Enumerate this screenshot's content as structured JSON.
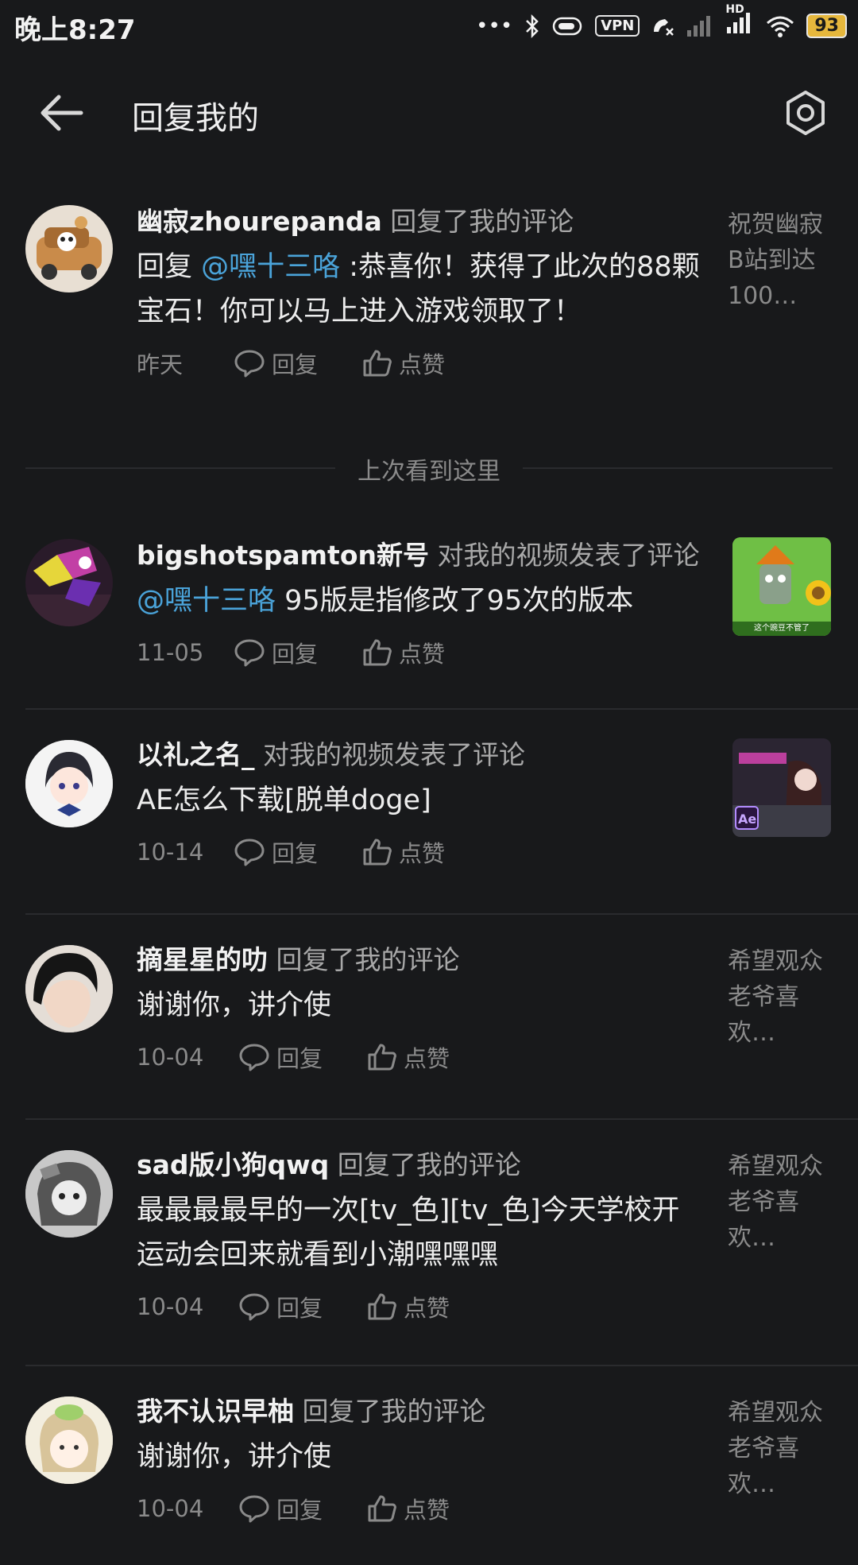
{
  "status": {
    "time": "晚上8:27",
    "vpn": "VPN",
    "signal_hd": "HD",
    "battery": "93"
  },
  "header": {
    "title": "回复我的"
  },
  "last_seen_label": "上次看到这里",
  "actions": {
    "reply": "回复",
    "like": "点赞"
  },
  "items": [
    {
      "user": "幽寂zhourepanda",
      "action": "回复了我的评论",
      "content_prefix": "回复 ",
      "mention": "@嘿十三咯",
      "content_suffix": " :恭喜你！获得了此次的88颗宝石！你可以马上进入游戏领取了！",
      "date": "昨天",
      "side_text": "祝贺幽寂B站到达100…"
    },
    {
      "user": "bigshotspamton新号",
      "action": "对我的视频发表了评论",
      "content_prefix": "",
      "mention": "@嘿十三咯",
      "content_suffix": " 95版是指修改了95次的版本",
      "date": "11-05",
      "thumb_caption": "这个豌豆不管了"
    },
    {
      "user": "以礼之名_",
      "action": "对我的视频发表了评论",
      "content_prefix": "AE怎么下载[脱单doge]",
      "mention": "",
      "content_suffix": "",
      "date": "10-14",
      "thumb_caption": "Ae"
    },
    {
      "user": "摘星星的叻",
      "action": "回复了我的评论",
      "content_prefix": "谢谢你，讲介使",
      "mention": "",
      "content_suffix": "",
      "date": "10-04",
      "side_text": "希望观众老爷喜欢…"
    },
    {
      "user": "sad版小狗qwq",
      "action": "回复了我的评论",
      "content_prefix": "最最最最早的一次[tv_色][tv_色]今天学校开运动会回来就看到小潮嘿嘿嘿",
      "mention": "",
      "content_suffix": "",
      "date": "10-04",
      "side_text": "希望观众老爷喜欢…"
    },
    {
      "user": "我不认识早柚",
      "action": "回复了我的评论",
      "content_prefix": "谢谢你，讲介使",
      "mention": "",
      "content_suffix": "",
      "date": "10-04",
      "side_text": "希望观众老爷喜欢…"
    }
  ]
}
